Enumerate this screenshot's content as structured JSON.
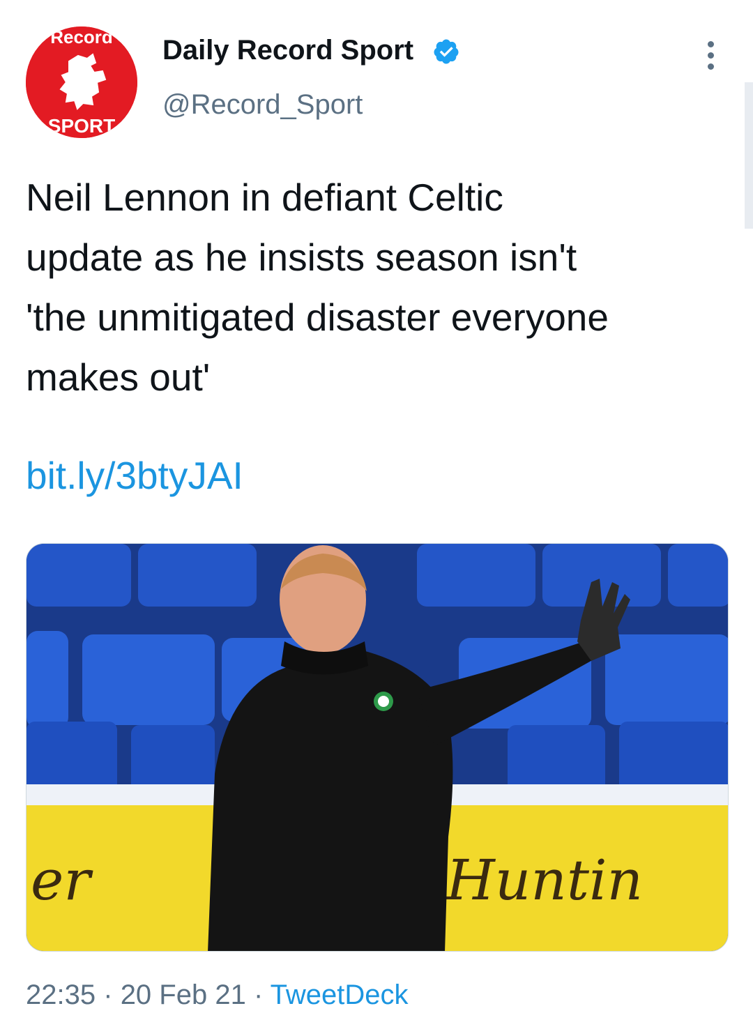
{
  "tweet": {
    "avatar": {
      "text_top": "Record",
      "text_bottom": "SPORT",
      "color": "#e31b23"
    },
    "display_name": "Daily Record Sport",
    "verified_icon": "verified-badge-icon",
    "handle": "@Record_Sport",
    "menu_icon": "more-options-icon",
    "text": "Neil Lennon in defiant Celtic\nupdate as he insists season isn't\n'the unmitigated disaster everyone\nmakes out'",
    "link": "bit.ly/3btyJAI",
    "media": {
      "banner_left": "er",
      "banner_right": "Huntin"
    },
    "meta": {
      "time": "22:35",
      "separator": "·",
      "date": "20 Feb 21",
      "source": "TweetDeck"
    }
  },
  "colors": {
    "link": "#1b95e0",
    "secondary_text": "#5b7083",
    "verified": "#1da1f2"
  }
}
